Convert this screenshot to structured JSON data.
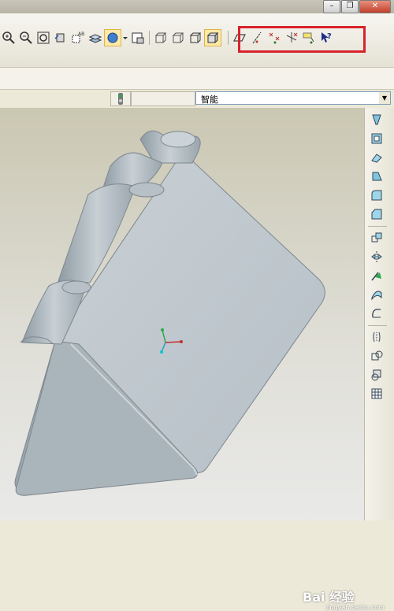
{
  "window": {
    "minimize": "–",
    "restore": "❐",
    "close": "✕"
  },
  "toolbar": {
    "left_icons": [
      "zoom-in-icon",
      "zoom-out-icon",
      "refit-icon",
      "reorient-icon",
      "saved-view-icon",
      "layers-icon",
      "display-style-icon",
      "dropdown-icon",
      "model-setup-icon"
    ],
    "view_icons": [
      "shaded-wireframe-icon",
      "hidden-line-icon",
      "no-hidden-icon",
      "shading-icon"
    ],
    "highlighted_icons": [
      "datum-plane-icon",
      "datum-axis-icon",
      "datum-point-icon",
      "coordinate-system-icon",
      "annotation-icon",
      "help-icon"
    ],
    "highlight_color": "#d6232c"
  },
  "status": {
    "filter_value": "智能"
  },
  "right_toolbar": {
    "icons": [
      "hole-icon",
      "shell-icon",
      "rib-icon",
      "draft-icon",
      "round-icon",
      "chamfer-icon",
      "pattern-icon",
      "mirror-icon",
      "trim-icon",
      "offset-icon",
      "extend-icon",
      "intersect-icon",
      "merge-icon",
      "solidify-icon",
      "thicken-icon"
    ]
  },
  "watermark": {
    "logo": "Bai 经验",
    "url": "jingyan.baidu.com"
  }
}
